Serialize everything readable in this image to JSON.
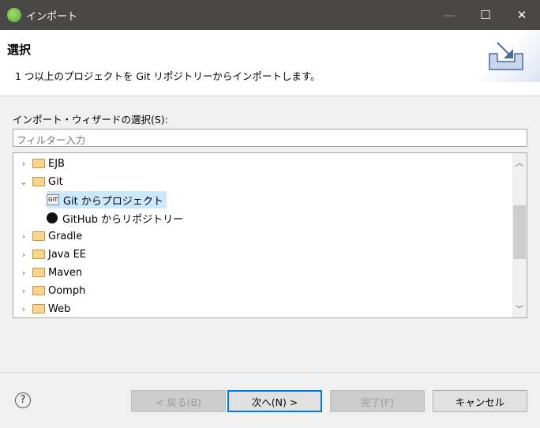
{
  "window": {
    "title": "インポート",
    "minimize": "—",
    "maximize": "☐",
    "close": "✕"
  },
  "header": {
    "title": "選択",
    "description": "1 つ以上のプロジェクトを Git リポジトリーからインポートします。"
  },
  "wizard_label": "インポート・ウィザードの選択(S):",
  "filter": {
    "placeholder": "フィルター入力",
    "value": ""
  },
  "tree": [
    {
      "label": "EJB",
      "type": "folder",
      "expanded": false
    },
    {
      "label": "Git",
      "type": "folder",
      "expanded": true
    },
    {
      "label": "Git からプロジェクト",
      "type": "git",
      "selected": true
    },
    {
      "label": "GitHub からリポジトリー",
      "type": "github"
    },
    {
      "label": "Gradle",
      "type": "folder",
      "expanded": false
    },
    {
      "label": "Java EE",
      "type": "folder",
      "expanded": false
    },
    {
      "label": "Maven",
      "type": "folder",
      "expanded": false
    },
    {
      "label": "Oomph",
      "type": "folder",
      "expanded": false
    },
    {
      "label": "Web",
      "type": "folder",
      "expanded": false
    }
  ],
  "buttons": {
    "help": "?",
    "back": "< 戻る(B)",
    "next": "次へ(N) >",
    "finish": "完了(F)",
    "cancel": "キャンセル"
  }
}
